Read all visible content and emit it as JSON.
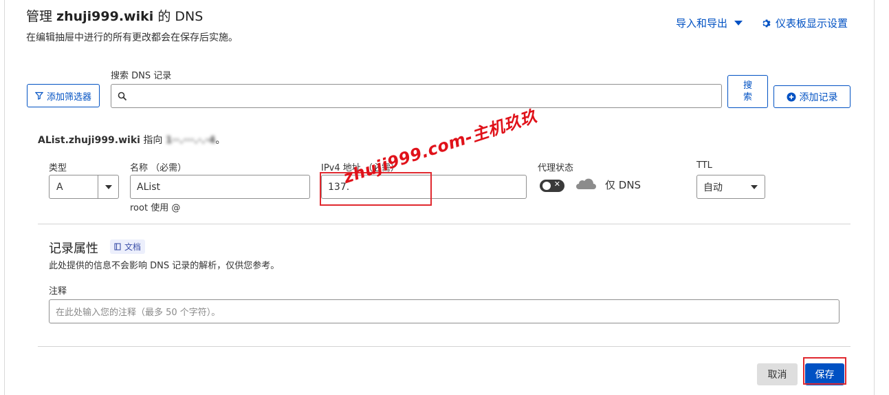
{
  "header": {
    "title_prefix": "管理 ",
    "title_domain": "zhuji999.wiki",
    "title_suffix": " 的 DNS",
    "subtitle": "在编辑抽屉中进行的所有更改都会在保存后实施。",
    "import_export_label": "导入和导出",
    "dashboard_settings_label": "仪表板显示设置"
  },
  "toolbar": {
    "add_filter_label": "添加筛选器",
    "search_label": "搜索 DNS 记录",
    "search_value": "",
    "search_button_label": "搜\n索",
    "add_record_label": "添加记录"
  },
  "record": {
    "summary_name": "AList.zhuji999.wiki",
    "summary_points_to": " 指向 ",
    "summary_ip_masked": "1··.···.·.·4",
    "summary_end": "。",
    "type_label": "类型",
    "type_value": "A",
    "name_label": "名称 （必需）",
    "name_value": "AList",
    "name_hint": "root 使用 @",
    "ipv4_label": "IPv4 地址 （必需）",
    "ipv4_value": "137.",
    "proxy_label": "代理状态",
    "proxy_status": "仅 DNS",
    "ttl_label": "TTL",
    "ttl_value": "自动"
  },
  "attributes": {
    "heading": "记录属性",
    "docs_badge": "文档",
    "description": "此处提供的信息不会影响 DNS 记录的解析，仅供您参考。",
    "comment_label": "注释",
    "comment_placeholder": "在此处输入您的注释（最多 50 个字符）。"
  },
  "actions": {
    "cancel_label": "取消",
    "save_label": "保存"
  },
  "watermark": "zhuji999.com-主机玖玖",
  "colors": {
    "accent": "#0051c3",
    "highlight": "#e0282e"
  }
}
